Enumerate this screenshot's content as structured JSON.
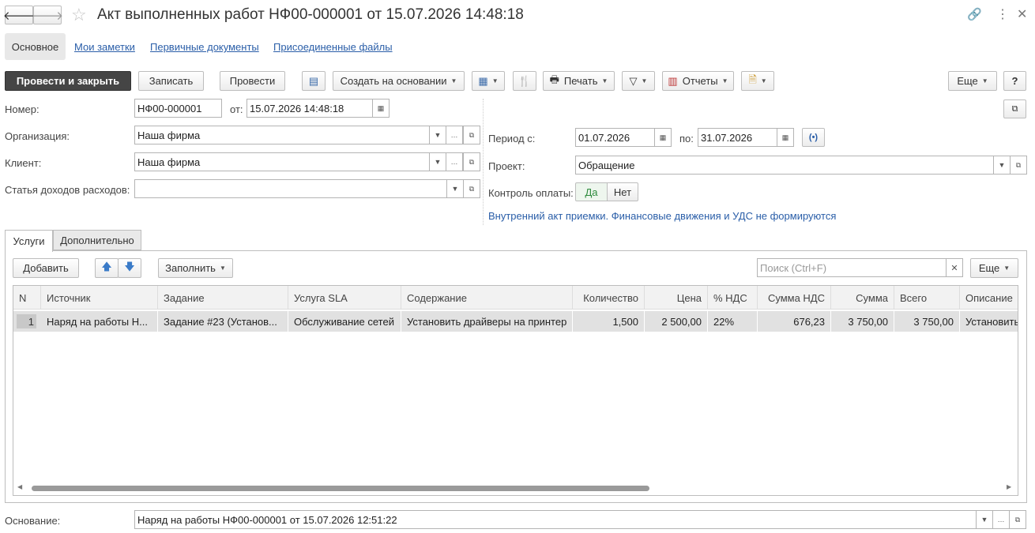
{
  "window": {
    "title": "Акт выполненных работ НФ00-000001 от 15.07.2026 14:48:18"
  },
  "tabs": [
    "Основное",
    "Мои заметки",
    "Первичные документы",
    "Присоединенные файлы"
  ],
  "toolbar": {
    "post_close": "Провести и закрыть",
    "save": "Записать",
    "post": "Провести",
    "create_based": "Создать на основании",
    "print": "Печать",
    "reports": "Отчеты",
    "more": "Еще",
    "help": "?"
  },
  "form": {
    "number_label": "Номер:",
    "number": "НФ00-000001",
    "from_label": "от:",
    "date": "15.07.2026 14:48:18",
    "org_label": "Организация:",
    "org": "Наша фирма",
    "client_label": "Клиент:",
    "client": "Наша фирма",
    "article_label": "Статья доходов расходов:",
    "article": "",
    "period_label": "Период с:",
    "period_from": "01.07.2026",
    "to_label": "по:",
    "period_to": "31.07.2026",
    "project_label": "Проект:",
    "project": "Обращение",
    "payment_label": "Контроль оплаты:",
    "yes": "Да",
    "no": "Нет",
    "info": "Внутренний акт приемки. Финансовые движения и УДС не формируются",
    "basis_label": "Основание:",
    "basis": "Наряд на работы НФ00-000001 от 15.07.2026 12:51:22"
  },
  "subtabs": [
    "Услуги",
    "Дополнительно"
  ],
  "table_toolbar": {
    "add": "Добавить",
    "fill": "Заполнить",
    "search_placeholder": "Поиск (Ctrl+F)",
    "more": "Еще"
  },
  "table": {
    "headers": [
      "N",
      "Источник",
      "Задание",
      "Услуга SLA",
      "Содержание",
      "Количество",
      "Цена",
      "% НДС",
      "Сумма НДС",
      "Сумма",
      "Всего",
      "Описание"
    ],
    "rows": [
      [
        "1",
        "Наряд на работы Н...",
        "Задание #23 (Установ...",
        "Обслуживание сетей",
        "Установить драйверы на принтер",
        "1,500",
        "2 500,00",
        "22%",
        "676,23",
        "3 750,00",
        "3 750,00",
        "Установить"
      ]
    ]
  }
}
